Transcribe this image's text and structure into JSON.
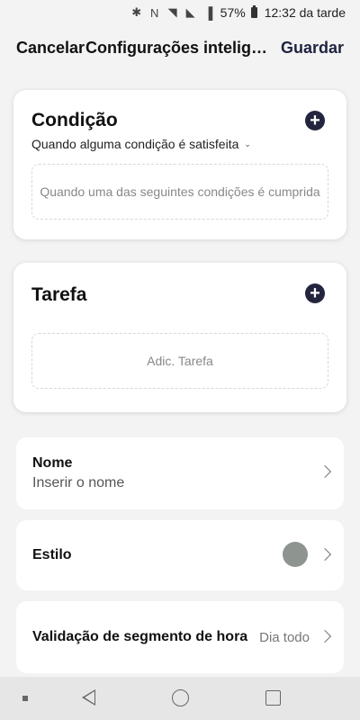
{
  "status_bar": {
    "battery": "57%",
    "time": "12:32 da tarde",
    "icons": [
      "bluetooth-icon",
      "nfc-icon",
      "wifi-icon",
      "no-sim-icon",
      "signal-icon",
      "battery-icon"
    ]
  },
  "header": {
    "cancel_label": "Cancelar",
    "title": "Configurações inteligentes",
    "save_label": "Guardar"
  },
  "condition": {
    "title": "Condição",
    "mode": "Quando alguma condição é satisfeita",
    "placeholder": "Quando uma das seguintes condições é cumprida"
  },
  "task": {
    "title": "Tarefa",
    "placeholder": "Adic. Tarefa"
  },
  "name_row": {
    "label": "Nome",
    "placeholder": "Inserir o nome"
  },
  "style_row": {
    "label": "Estilo",
    "color": "#8e948f"
  },
  "time_row": {
    "label": "Validação de segmento de hora",
    "value": "Dia todo"
  },
  "colors": {
    "accent": "#23243d",
    "background": "#f3f3f3"
  }
}
